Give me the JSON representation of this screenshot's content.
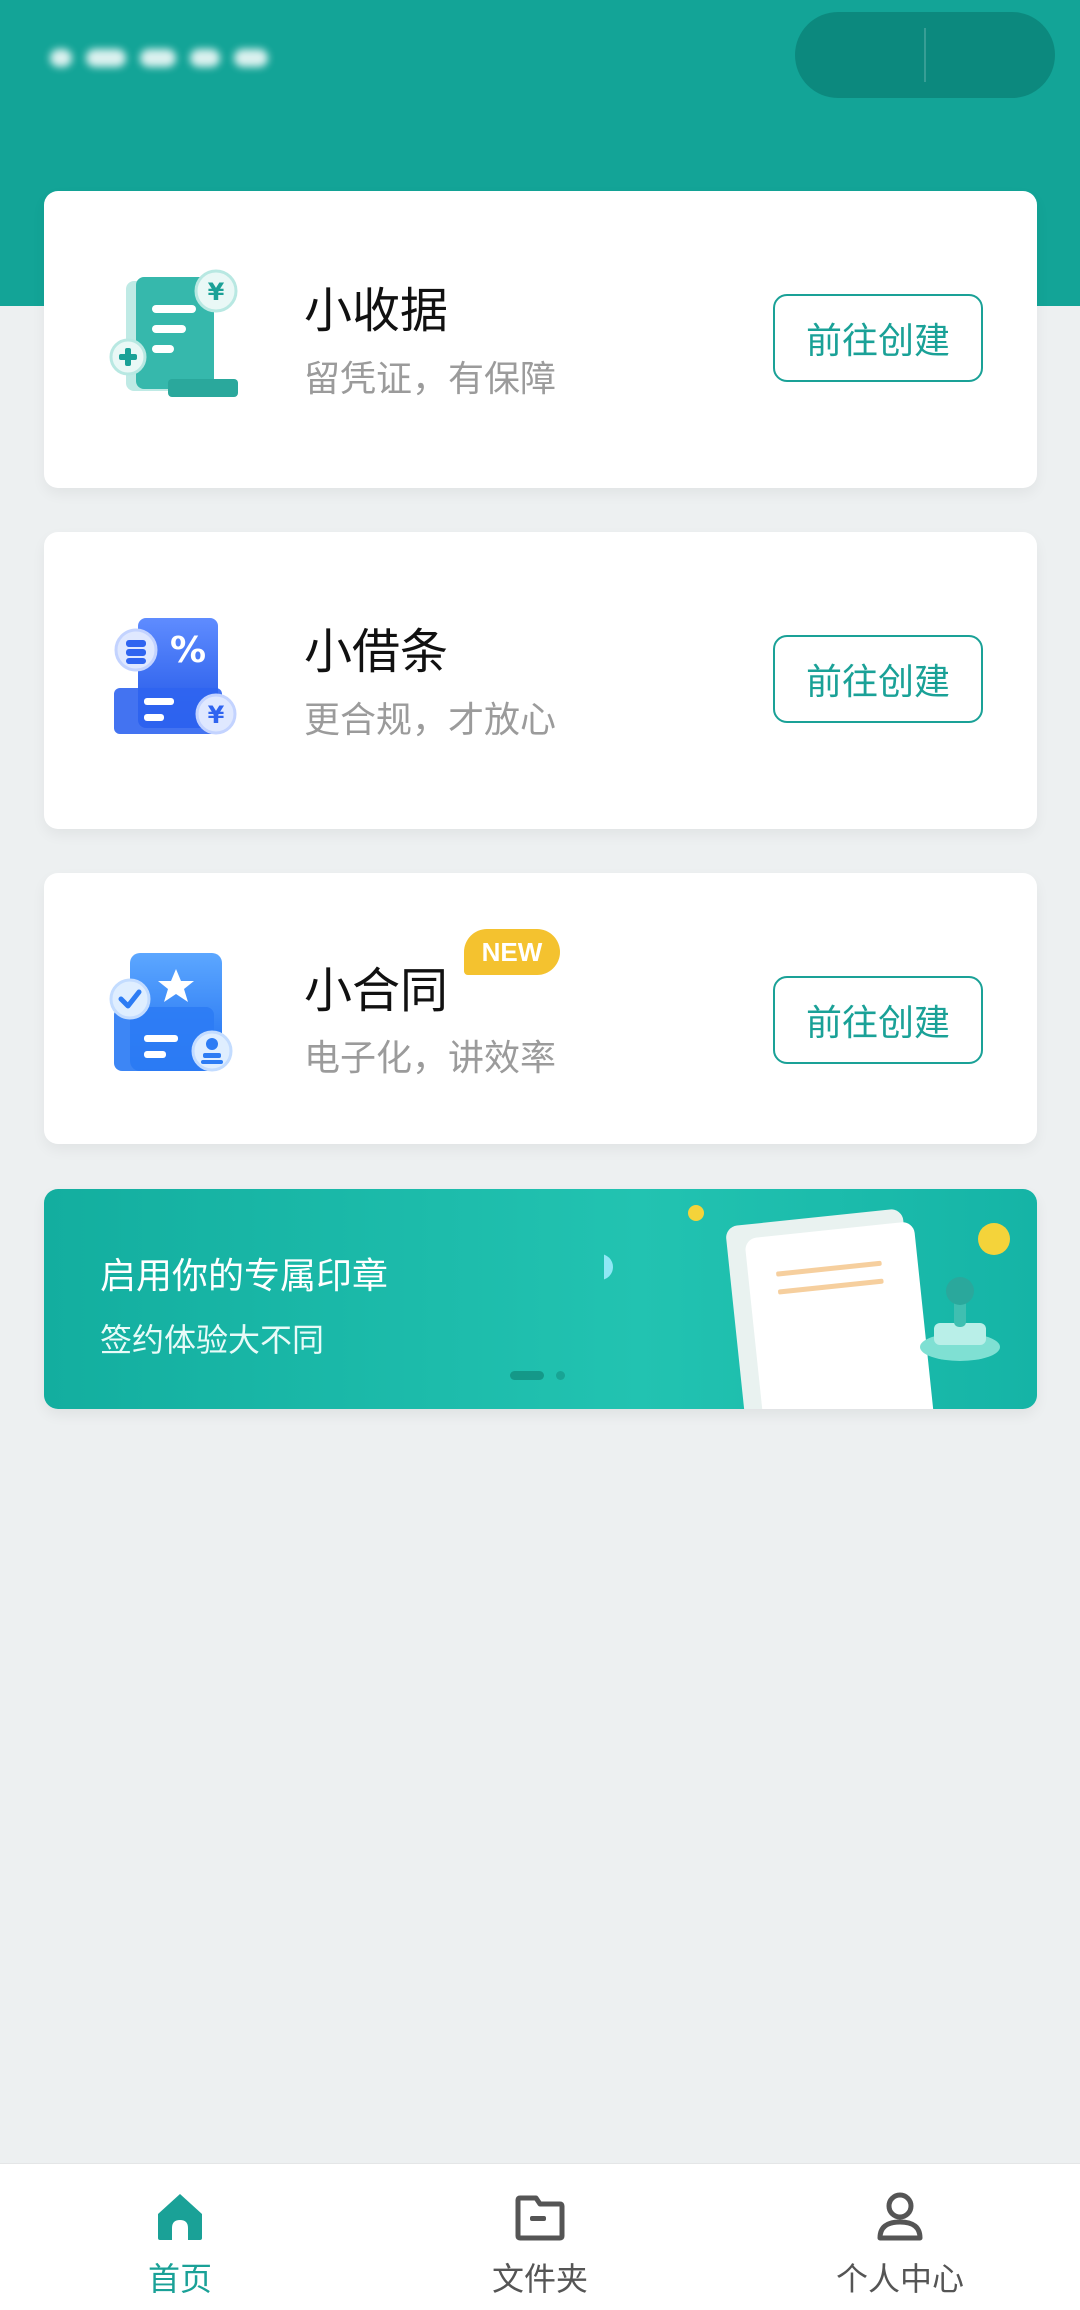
{
  "cards": [
    {
      "title": "小收据",
      "subtitle": "留凭证，有保障",
      "button": "前往创建",
      "icon": "receipt-icon",
      "badge": ""
    },
    {
      "title": "小借条",
      "subtitle": "更合规，才放心",
      "button": "前往创建",
      "icon": "iou-icon",
      "badge": ""
    },
    {
      "title": "小合同",
      "subtitle": "电子化，讲效率",
      "button": "前往创建",
      "icon": "contract-icon",
      "badge": "NEW"
    }
  ],
  "banner": {
    "title": "启用你的专属印章",
    "subtitle": "签约体验大不同",
    "slides": 2,
    "active_slide": 1
  },
  "tabbar": {
    "items": [
      {
        "label": "首页",
        "icon": "home-icon",
        "active": true
      },
      {
        "label": "文件夹",
        "icon": "folder-icon",
        "active": false
      },
      {
        "label": "个人中心",
        "icon": "user-icon",
        "active": false
      }
    ]
  },
  "colors": {
    "brand": "#13a497",
    "button": "#1aa197",
    "badge": "#f4c22f",
    "background": "#edf0f1"
  }
}
